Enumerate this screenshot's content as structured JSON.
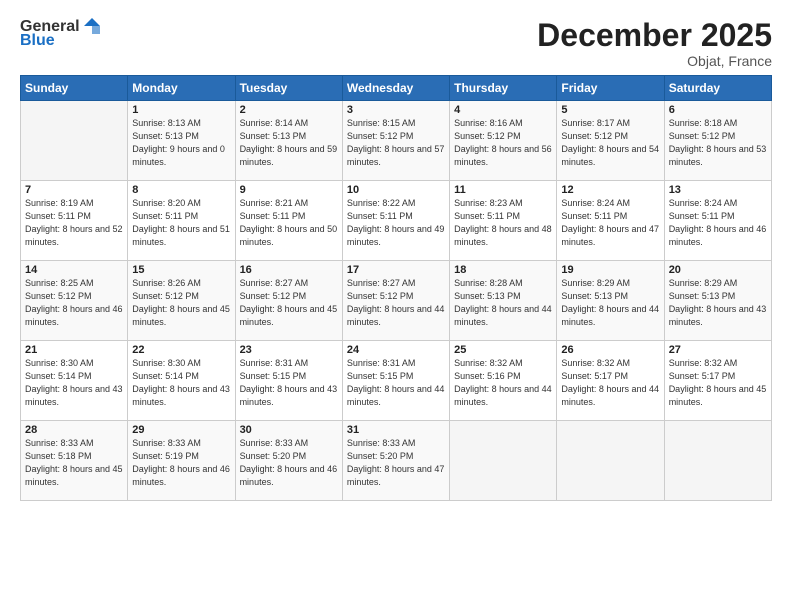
{
  "header": {
    "logo_general": "General",
    "logo_blue": "Blue",
    "month_title": "December 2025",
    "location": "Objat, France"
  },
  "days_of_week": [
    "Sunday",
    "Monday",
    "Tuesday",
    "Wednesday",
    "Thursday",
    "Friday",
    "Saturday"
  ],
  "weeks": [
    [
      {
        "day": "",
        "sunrise": "",
        "sunset": "",
        "daylight": ""
      },
      {
        "day": "1",
        "sunrise": "Sunrise: 8:13 AM",
        "sunset": "Sunset: 5:13 PM",
        "daylight": "Daylight: 9 hours and 0 minutes."
      },
      {
        "day": "2",
        "sunrise": "Sunrise: 8:14 AM",
        "sunset": "Sunset: 5:13 PM",
        "daylight": "Daylight: 8 hours and 59 minutes."
      },
      {
        "day": "3",
        "sunrise": "Sunrise: 8:15 AM",
        "sunset": "Sunset: 5:12 PM",
        "daylight": "Daylight: 8 hours and 57 minutes."
      },
      {
        "day": "4",
        "sunrise": "Sunrise: 8:16 AM",
        "sunset": "Sunset: 5:12 PM",
        "daylight": "Daylight: 8 hours and 56 minutes."
      },
      {
        "day": "5",
        "sunrise": "Sunrise: 8:17 AM",
        "sunset": "Sunset: 5:12 PM",
        "daylight": "Daylight: 8 hours and 54 minutes."
      },
      {
        "day": "6",
        "sunrise": "Sunrise: 8:18 AM",
        "sunset": "Sunset: 5:12 PM",
        "daylight": "Daylight: 8 hours and 53 minutes."
      }
    ],
    [
      {
        "day": "7",
        "sunrise": "Sunrise: 8:19 AM",
        "sunset": "Sunset: 5:11 PM",
        "daylight": "Daylight: 8 hours and 52 minutes."
      },
      {
        "day": "8",
        "sunrise": "Sunrise: 8:20 AM",
        "sunset": "Sunset: 5:11 PM",
        "daylight": "Daylight: 8 hours and 51 minutes."
      },
      {
        "day": "9",
        "sunrise": "Sunrise: 8:21 AM",
        "sunset": "Sunset: 5:11 PM",
        "daylight": "Daylight: 8 hours and 50 minutes."
      },
      {
        "day": "10",
        "sunrise": "Sunrise: 8:22 AM",
        "sunset": "Sunset: 5:11 PM",
        "daylight": "Daylight: 8 hours and 49 minutes."
      },
      {
        "day": "11",
        "sunrise": "Sunrise: 8:23 AM",
        "sunset": "Sunset: 5:11 PM",
        "daylight": "Daylight: 8 hours and 48 minutes."
      },
      {
        "day": "12",
        "sunrise": "Sunrise: 8:24 AM",
        "sunset": "Sunset: 5:11 PM",
        "daylight": "Daylight: 8 hours and 47 minutes."
      },
      {
        "day": "13",
        "sunrise": "Sunrise: 8:24 AM",
        "sunset": "Sunset: 5:11 PM",
        "daylight": "Daylight: 8 hours and 46 minutes."
      }
    ],
    [
      {
        "day": "14",
        "sunrise": "Sunrise: 8:25 AM",
        "sunset": "Sunset: 5:12 PM",
        "daylight": "Daylight: 8 hours and 46 minutes."
      },
      {
        "day": "15",
        "sunrise": "Sunrise: 8:26 AM",
        "sunset": "Sunset: 5:12 PM",
        "daylight": "Daylight: 8 hours and 45 minutes."
      },
      {
        "day": "16",
        "sunrise": "Sunrise: 8:27 AM",
        "sunset": "Sunset: 5:12 PM",
        "daylight": "Daylight: 8 hours and 45 minutes."
      },
      {
        "day": "17",
        "sunrise": "Sunrise: 8:27 AM",
        "sunset": "Sunset: 5:12 PM",
        "daylight": "Daylight: 8 hours and 44 minutes."
      },
      {
        "day": "18",
        "sunrise": "Sunrise: 8:28 AM",
        "sunset": "Sunset: 5:13 PM",
        "daylight": "Daylight: 8 hours and 44 minutes."
      },
      {
        "day": "19",
        "sunrise": "Sunrise: 8:29 AM",
        "sunset": "Sunset: 5:13 PM",
        "daylight": "Daylight: 8 hours and 44 minutes."
      },
      {
        "day": "20",
        "sunrise": "Sunrise: 8:29 AM",
        "sunset": "Sunset: 5:13 PM",
        "daylight": "Daylight: 8 hours and 43 minutes."
      }
    ],
    [
      {
        "day": "21",
        "sunrise": "Sunrise: 8:30 AM",
        "sunset": "Sunset: 5:14 PM",
        "daylight": "Daylight: 8 hours and 43 minutes."
      },
      {
        "day": "22",
        "sunrise": "Sunrise: 8:30 AM",
        "sunset": "Sunset: 5:14 PM",
        "daylight": "Daylight: 8 hours and 43 minutes."
      },
      {
        "day": "23",
        "sunrise": "Sunrise: 8:31 AM",
        "sunset": "Sunset: 5:15 PM",
        "daylight": "Daylight: 8 hours and 43 minutes."
      },
      {
        "day": "24",
        "sunrise": "Sunrise: 8:31 AM",
        "sunset": "Sunset: 5:15 PM",
        "daylight": "Daylight: 8 hours and 44 minutes."
      },
      {
        "day": "25",
        "sunrise": "Sunrise: 8:32 AM",
        "sunset": "Sunset: 5:16 PM",
        "daylight": "Daylight: 8 hours and 44 minutes."
      },
      {
        "day": "26",
        "sunrise": "Sunrise: 8:32 AM",
        "sunset": "Sunset: 5:17 PM",
        "daylight": "Daylight: 8 hours and 44 minutes."
      },
      {
        "day": "27",
        "sunrise": "Sunrise: 8:32 AM",
        "sunset": "Sunset: 5:17 PM",
        "daylight": "Daylight: 8 hours and 45 minutes."
      }
    ],
    [
      {
        "day": "28",
        "sunrise": "Sunrise: 8:33 AM",
        "sunset": "Sunset: 5:18 PM",
        "daylight": "Daylight: 8 hours and 45 minutes."
      },
      {
        "day": "29",
        "sunrise": "Sunrise: 8:33 AM",
        "sunset": "Sunset: 5:19 PM",
        "daylight": "Daylight: 8 hours and 46 minutes."
      },
      {
        "day": "30",
        "sunrise": "Sunrise: 8:33 AM",
        "sunset": "Sunset: 5:20 PM",
        "daylight": "Daylight: 8 hours and 46 minutes."
      },
      {
        "day": "31",
        "sunrise": "Sunrise: 8:33 AM",
        "sunset": "Sunset: 5:20 PM",
        "daylight": "Daylight: 8 hours and 47 minutes."
      },
      {
        "day": "",
        "sunrise": "",
        "sunset": "",
        "daylight": ""
      },
      {
        "day": "",
        "sunrise": "",
        "sunset": "",
        "daylight": ""
      },
      {
        "day": "",
        "sunrise": "",
        "sunset": "",
        "daylight": ""
      }
    ]
  ]
}
